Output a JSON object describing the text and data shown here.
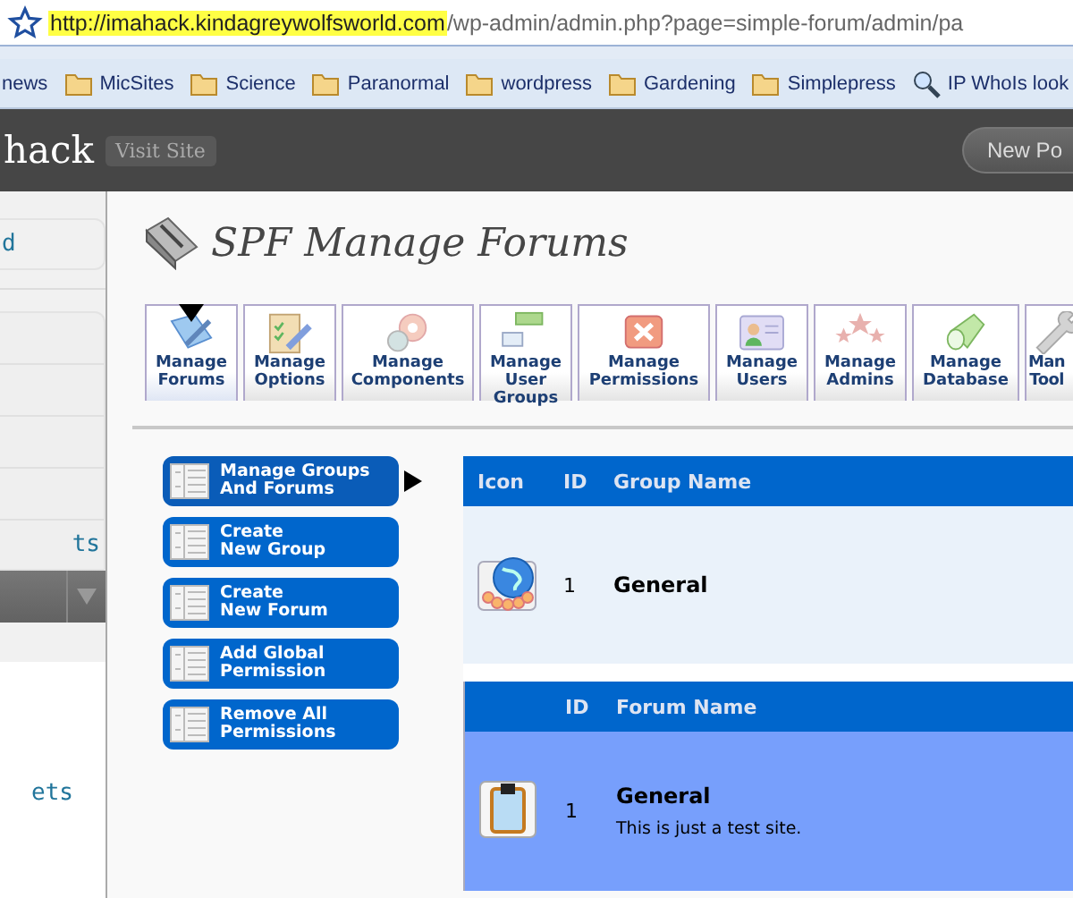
{
  "browser": {
    "url_host": "http://imahack.kindagreywolfsworld.com",
    "url_path": "/wp-admin/admin.php?page=simple-forum/admin/pa",
    "bookmarks": [
      {
        "label": "news",
        "kind": "plain"
      },
      {
        "label": "MicSites",
        "kind": "folder"
      },
      {
        "label": "Science",
        "kind": "folder"
      },
      {
        "label": "Paranormal",
        "kind": "folder"
      },
      {
        "label": "wordpress",
        "kind": "folder"
      },
      {
        "label": "Gardening",
        "kind": "folder"
      },
      {
        "label": "Simplepress",
        "kind": "folder"
      },
      {
        "label": "IP WhoIs look",
        "kind": "search"
      }
    ]
  },
  "wp_header": {
    "site_name": "hack",
    "visit_site": "Visit Site",
    "new_post": "New Po"
  },
  "sidebar": {
    "top_link": "d",
    "menu_link": "ts",
    "submenu_link": "ets"
  },
  "page": {
    "title": "SPF Manage Forums",
    "toolbar": [
      {
        "label": "Manage\nForums",
        "selected": true
      },
      {
        "label": "Manage\nOptions",
        "selected": false
      },
      {
        "label": "Manage\nComponents",
        "selected": false
      },
      {
        "label": "Manage\nUser\nGroups",
        "selected": false
      },
      {
        "label": "Manage\nPermissions",
        "selected": false
      },
      {
        "label": "Manage\nUsers",
        "selected": false
      },
      {
        "label": "Manage\nAdmins",
        "selected": false
      },
      {
        "label": "Manage\nDatabase",
        "selected": false
      },
      {
        "label": "Man\nTool",
        "selected": false
      }
    ],
    "actions": [
      {
        "label": "Manage Groups\nAnd Forums",
        "selected": true
      },
      {
        "label": "Create\nNew Group",
        "selected": false
      },
      {
        "label": "Create\nNew Forum",
        "selected": false
      },
      {
        "label": "Add Global\nPermission",
        "selected": false
      },
      {
        "label": "Remove All\nPermissions",
        "selected": false
      }
    ],
    "groups_table": {
      "columns": [
        "Icon",
        "ID",
        "Group Name"
      ],
      "rows": [
        {
          "id": "1",
          "name": "General"
        }
      ]
    },
    "forums_table": {
      "columns": [
        "ID",
        "Forum Name"
      ],
      "rows": [
        {
          "id": "1",
          "name": "General",
          "description": "This is just a test site.",
          "selected": true
        }
      ]
    }
  }
}
